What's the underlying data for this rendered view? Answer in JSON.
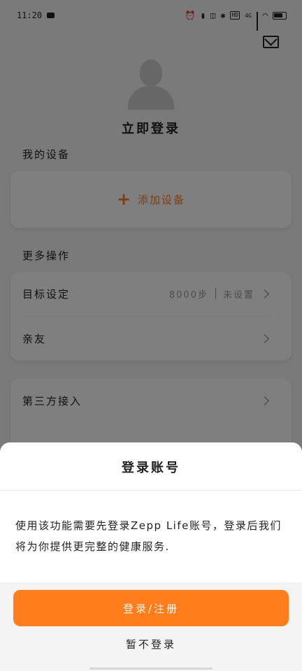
{
  "status_bar": {
    "time": "11:20",
    "network": "4G",
    "hd": "HD",
    "icons": [
      "alarm-icon",
      "vibrate-icon",
      "nfc-icon",
      "bluetooth-icon",
      "hd-icon",
      "signal-icon",
      "wifi-icon",
      "battery-icon"
    ]
  },
  "header": {
    "login_title": "立即登录"
  },
  "devices": {
    "section_title": "我的设备",
    "add_label": "添加设备"
  },
  "more": {
    "section_title": "更多操作",
    "goal": {
      "label": "目标设定",
      "value": "8000步",
      "status": "未设置"
    },
    "friends": {
      "label": "亲友"
    },
    "third_party": {
      "label": "第三方接入"
    }
  },
  "sheet": {
    "title": "登录账号",
    "message": "使用该功能需要先登录Zepp Life账号，登录后我们将为你提供更完整的健康服务.",
    "primary_label": "登录/注册",
    "secondary_label": "暂不登录"
  },
  "colors": {
    "accent": "#ff7d1a",
    "overlay": "rgba(0,0,0,0.5)"
  }
}
